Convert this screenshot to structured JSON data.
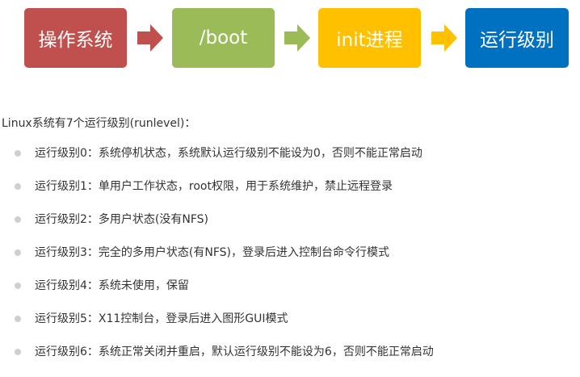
{
  "flow": {
    "steps": [
      {
        "label": "操作系统",
        "color": "#c0504d"
      },
      {
        "label": "/boot",
        "color": "#9bbb59"
      },
      {
        "label": "init进程",
        "color": "#ffc000"
      },
      {
        "label": "运行级别",
        "color": "#0070c0"
      }
    ],
    "arrows": [
      {
        "color": "#c0504d"
      },
      {
        "color": "#9bbb59"
      },
      {
        "color": "#ffc000"
      }
    ]
  },
  "intro": "Linux系统有7个运行级别(runlevel)：",
  "levels": [
    "运行级别0：系统停机状态，系统默认运行级别不能设为0，否则不能正常启动",
    "运行级别1：单用户工作状态，root权限，用于系统维护，禁止远程登录",
    "运行级别2：多用户状态(没有NFS)",
    "运行级别3：完全的多用户状态(有NFS)，登录后进入控制台命令行模式",
    "运行级别4：系统未使用，保留",
    "运行级别5：X11控制台，登录后进入图形GUI模式",
    "运行级别6：系统正常关闭并重启，默认运行级别不能设为6，否则不能正常启动"
  ]
}
